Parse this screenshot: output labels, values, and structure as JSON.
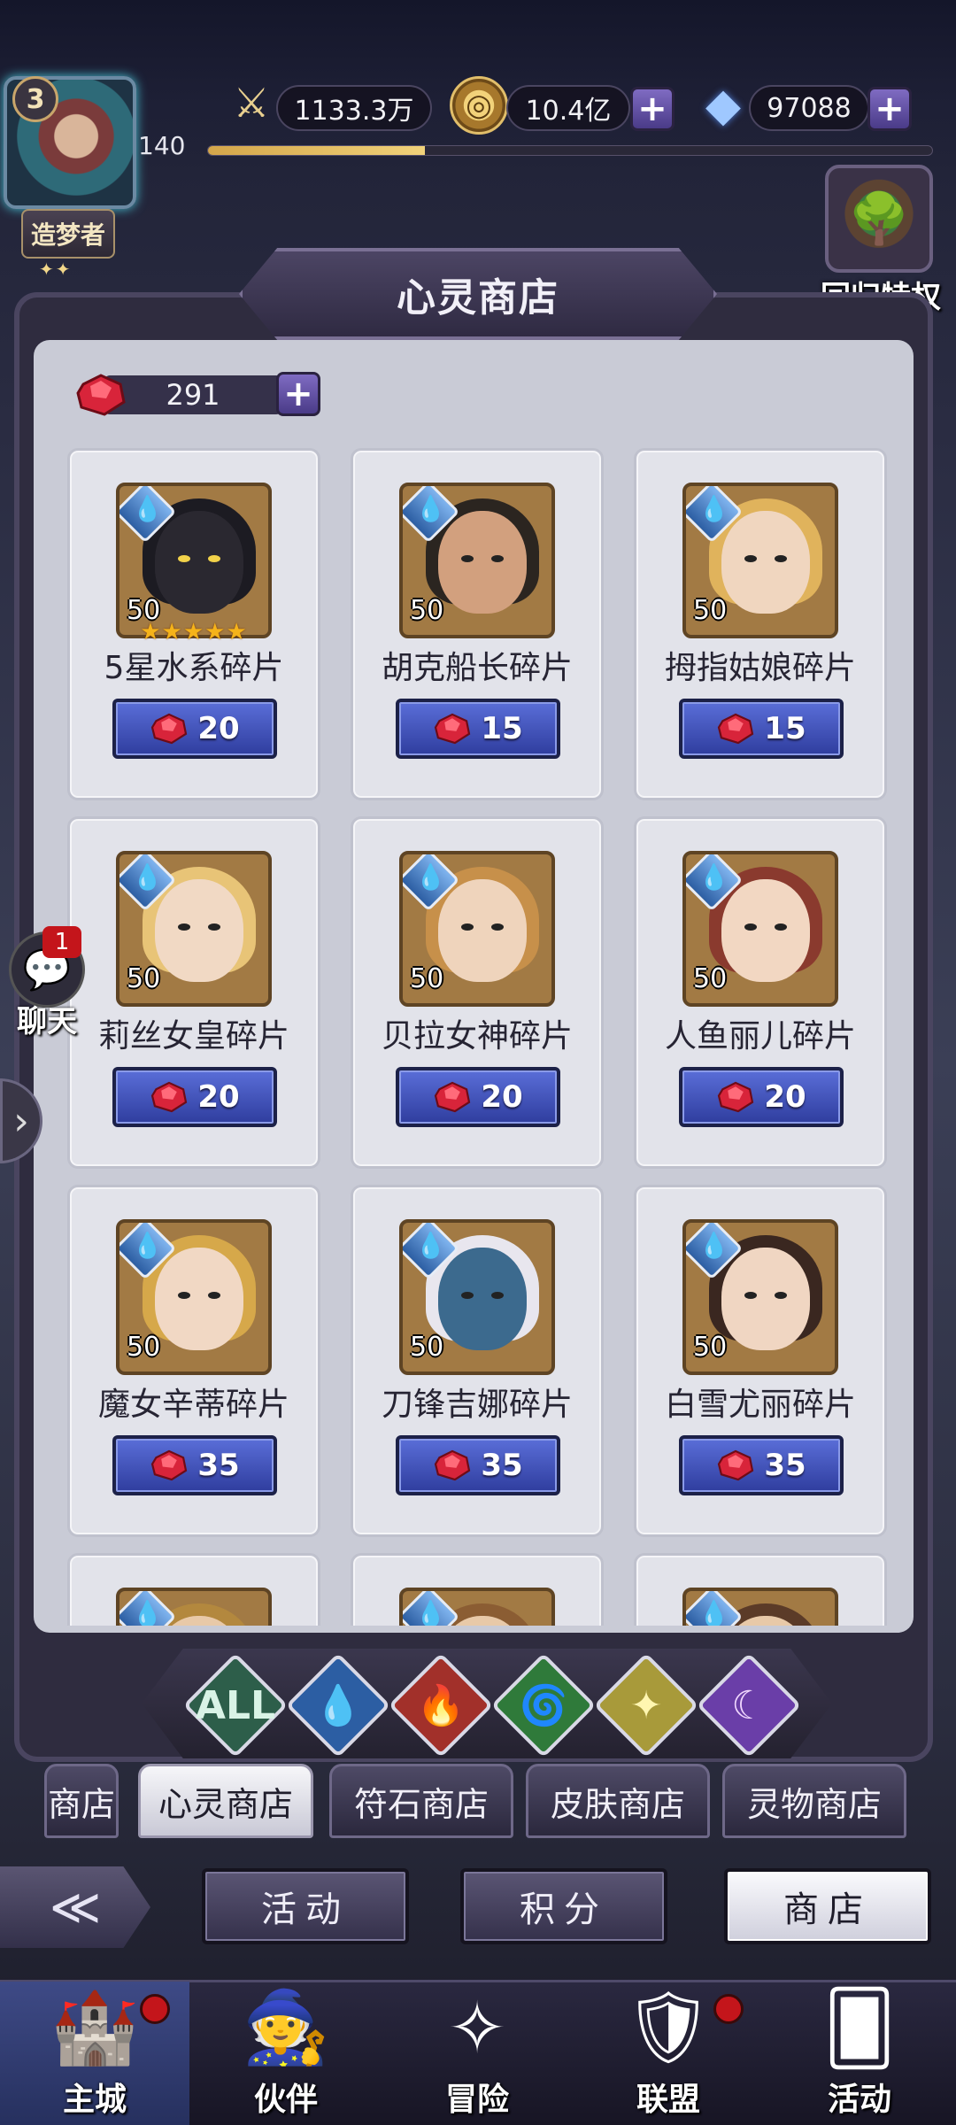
{
  "player": {
    "level": "3",
    "title": "造梦者",
    "title_stars": "✦✦",
    "account_level": "140",
    "exp_progress": 0.3
  },
  "resources": {
    "power": "1133.3万",
    "gold": "10.4亿",
    "diamonds": "97088"
  },
  "return_privilege": {
    "label": "回归特权"
  },
  "shop": {
    "title": "心灵商店",
    "gem_count": "291"
  },
  "items": [
    {
      "name": "5星水系碎片",
      "count": "50",
      "price": "20",
      "stars": "★★★★★",
      "element": "water",
      "hair": "#1c1b22",
      "face": "#2a2830",
      "eye": "#f2d24a"
    },
    {
      "name": "胡克船长碎片",
      "count": "50",
      "price": "15",
      "element": "water",
      "hair": "#2b2520",
      "face": "#d2a07e",
      "eye": "#222"
    },
    {
      "name": "拇指姑娘碎片",
      "count": "50",
      "price": "15",
      "element": "water",
      "hair": "#e0b35c",
      "face": "#f0d6bf",
      "eye": "#222"
    },
    {
      "name": "莉丝女皇碎片",
      "count": "50",
      "price": "20",
      "element": "water",
      "hair": "#e8c477",
      "face": "#f1d9c4",
      "eye": "#222"
    },
    {
      "name": "贝拉女神碎片",
      "count": "50",
      "price": "20",
      "element": "water",
      "hair": "#c7904a",
      "face": "#efd4bc",
      "eye": "#222"
    },
    {
      "name": "人鱼丽儿碎片",
      "count": "50",
      "price": "20",
      "element": "water",
      "hair": "#8a3a2e",
      "face": "#f2d7c2",
      "eye": "#222"
    },
    {
      "name": "魔女辛蒂碎片",
      "count": "50",
      "price": "35",
      "element": "water",
      "hair": "#d6a84a",
      "face": "#f1d8c4",
      "eye": "#222"
    },
    {
      "name": "刀锋吉娜碎片",
      "count": "50",
      "price": "35",
      "element": "water",
      "hair": "#e8e6ee",
      "face": "#3c6a8e",
      "eye": "#222"
    },
    {
      "name": "白雪尤丽碎片",
      "count": "50",
      "price": "35",
      "element": "water",
      "hair": "#3a2720",
      "face": "#f0d6c2",
      "eye": "#222"
    },
    {
      "name": "",
      "count": "",
      "price": "",
      "element": "water",
      "hair": "#b3883e",
      "face": "#e8c9a8",
      "eye": "#222"
    },
    {
      "name": "",
      "count": "",
      "price": "",
      "element": "water",
      "hair": "#8b5d33",
      "face": "#e8c9a8",
      "eye": "#222"
    },
    {
      "name": "",
      "count": "",
      "price": "",
      "element": "water",
      "hair": "#5b3b28",
      "face": "#e8c9a8",
      "eye": "#222"
    }
  ],
  "filters": [
    {
      "id": "all",
      "label": "ALL",
      "color": "#2d5e4a",
      "fg": "#d9f3e6"
    },
    {
      "id": "water",
      "label": "💧",
      "color": "#2c5ea3",
      "fg": "#bfe0ff"
    },
    {
      "id": "fire",
      "label": "🔥",
      "color": "#a2302a",
      "fg": "#ffd0a0"
    },
    {
      "id": "wind",
      "label": "🌀",
      "color": "#2f7a3a",
      "fg": "#bdf2b8"
    },
    {
      "id": "light",
      "label": "✦",
      "color": "#a89a3a",
      "fg": "#fff6b0"
    },
    {
      "id": "dark",
      "label": "☾",
      "color": "#6a3ea8",
      "fg": "#f1d8ff"
    }
  ],
  "shop_tabs": [
    {
      "label": "商店",
      "active": false
    },
    {
      "label": "心灵商店",
      "active": true
    },
    {
      "label": "符石商店",
      "active": false
    },
    {
      "label": "皮肤商店",
      "active": false
    },
    {
      "label": "灵物商店",
      "active": false
    }
  ],
  "sub_nav": {
    "back_icon": "≪",
    "activity": "活动",
    "points": "积分",
    "shop": "商店"
  },
  "chat": {
    "badge": "1",
    "label": "聊天"
  },
  "bottom_nav": [
    {
      "label": "主城",
      "icon": "🏰",
      "active": true,
      "dot": true
    },
    {
      "label": "伙伴",
      "icon": "🧙",
      "active": false,
      "dot": false
    },
    {
      "label": "冒险",
      "icon": "✧",
      "active": false,
      "dot": false
    },
    {
      "label": "联盟",
      "icon": "🛡",
      "active": false,
      "dot": true
    },
    {
      "label": "活动",
      "icon": "🂠",
      "active": false,
      "dot": false
    }
  ],
  "colors": {
    "accent": "#3d4cb6",
    "gem": "#d8243a",
    "panel": "#c9cbd6"
  }
}
